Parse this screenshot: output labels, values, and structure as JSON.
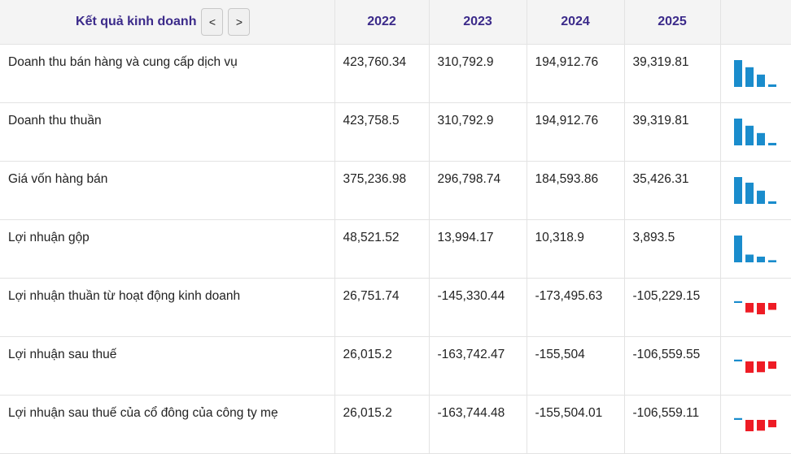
{
  "header": {
    "title": "Kết quả kinh doanh",
    "prev_label": "<",
    "next_label": ">",
    "years": [
      "2022",
      "2023",
      "2024",
      "2025"
    ]
  },
  "colors": {
    "positive": "#1a8ccc",
    "negative": "#ee1c25"
  },
  "rows": [
    {
      "label": "Doanh thu bán hàng và cung cấp dịch vụ",
      "values": [
        "423,760.34",
        "310,792.9",
        "194,912.76",
        "39,319.81"
      ],
      "numeric": [
        423760.34,
        310792.9,
        194912.76,
        39319.81
      ]
    },
    {
      "label": "Doanh thu thuần",
      "values": [
        "423,758.5",
        "310,792.9",
        "194,912.76",
        "39,319.81"
      ],
      "numeric": [
        423758.5,
        310792.9,
        194912.76,
        39319.81
      ]
    },
    {
      "label": "Giá vốn hàng bán",
      "values": [
        "375,236.98",
        "296,798.74",
        "184,593.86",
        "35,426.31"
      ],
      "numeric": [
        375236.98,
        296798.74,
        184593.86,
        35426.31
      ]
    },
    {
      "label": "Lợi nhuận gộp",
      "values": [
        "48,521.52",
        "13,994.17",
        "10,318.9",
        "3,893.5"
      ],
      "numeric": [
        48521.52,
        13994.17,
        10318.9,
        3893.5
      ]
    },
    {
      "label": "Lợi nhuận thuần từ hoạt động kinh doanh",
      "values": [
        "26,751.74",
        "-145,330.44",
        "-173,495.63",
        "-105,229.15"
      ],
      "numeric": [
        26751.74,
        -145330.44,
        -173495.63,
        -105229.15
      ]
    },
    {
      "label": "Lợi nhuận sau thuế",
      "values": [
        "26,015.2",
        "-163,742.47",
        "-155,504",
        "-106,559.55"
      ],
      "numeric": [
        26015.2,
        -163742.47,
        -155504,
        -106559.55
      ]
    },
    {
      "label": "Lợi nhuận sau thuế của cổ đông của công ty mẹ",
      "values": [
        "26,015.2",
        "-163,744.48",
        "-155,504.01",
        "-106,559.11"
      ],
      "numeric": [
        26015.2,
        -163744.48,
        -155504.01,
        -106559.11
      ]
    }
  ]
}
